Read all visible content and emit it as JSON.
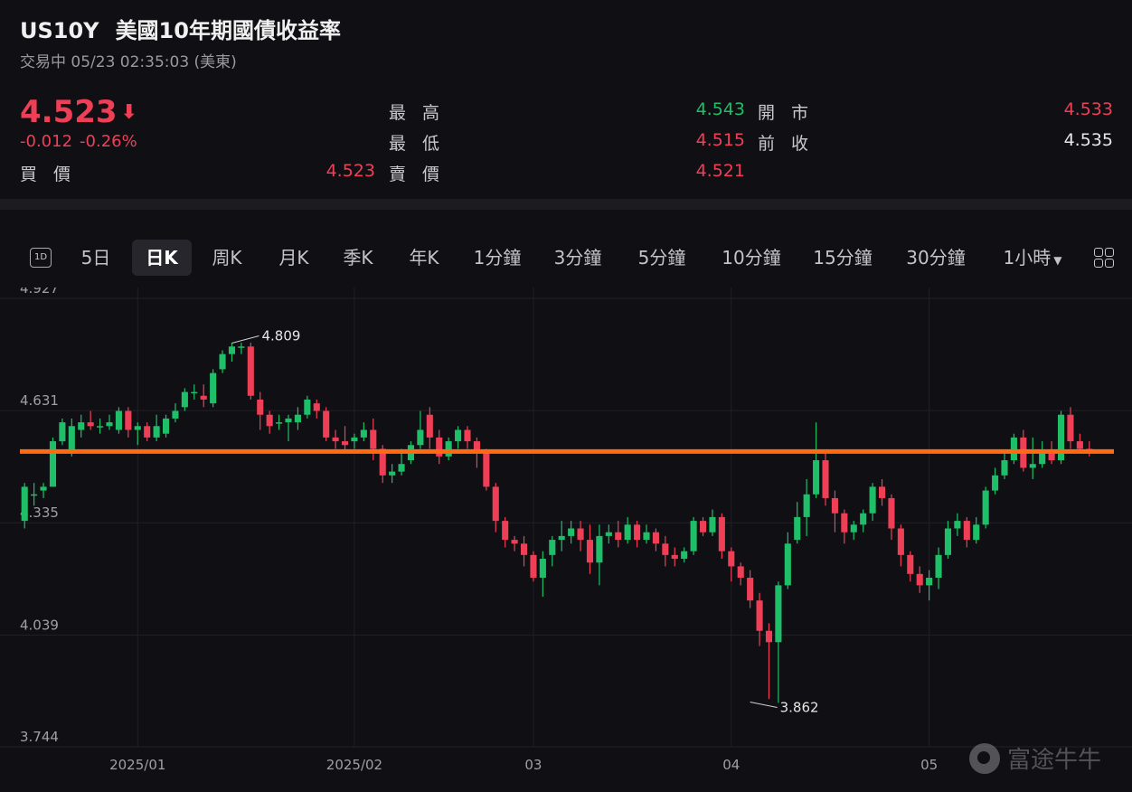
{
  "header": {
    "symbol": "US10Y",
    "name": "美國10年期國債收益率",
    "status": "交易中 05/23 02:35:03 (美東)"
  },
  "quote": {
    "price": "4.523",
    "change": "-0.012",
    "change_pct": "-0.26%",
    "bid_label": "買 價",
    "bid": "4.523",
    "high_label": "最 高",
    "high": "4.543",
    "low_label": "最 低",
    "low": "4.515",
    "ask_label": "賣 價",
    "ask": "4.521",
    "open_label": "開 市",
    "open": "4.533",
    "prev_label": "前 收",
    "prev": "4.535"
  },
  "tabs": [
    "5日",
    "日K",
    "周K",
    "月K",
    "季K",
    "年K",
    "1分鐘",
    "3分鐘",
    "5分鐘",
    "10分鐘",
    "15分鐘",
    "30分鐘",
    "1小時"
  ],
  "tab_oned": "1D",
  "active_tab": "日K",
  "colors": {
    "up": "#1fbf6a",
    "down": "#ee3f57",
    "level_line": "#ff6a13",
    "background": "#101014"
  },
  "watermark": "富途牛牛",
  "chart_data": {
    "type": "candlestick",
    "ylim": [
      3.744,
      4.927
    ],
    "y_ticks": [
      "4.927",
      "4.631",
      "4.335",
      "4.039",
      "3.744"
    ],
    "x_ticks": [
      {
        "label": "2025/01",
        "index": 12
      },
      {
        "label": "2025/02",
        "index": 35
      },
      {
        "label": "03",
        "index": 54
      },
      {
        "label": "04",
        "index": 75
      },
      {
        "label": "05",
        "index": 96
      }
    ],
    "level_line": 4.523,
    "annotations": [
      {
        "label": "4.809",
        "index": 22,
        "value": 4.809
      },
      {
        "label": "3.862",
        "index": 77,
        "value": 3.862
      }
    ],
    "candles": [
      [
        4.34,
        4.43,
        4.44,
        4.32
      ],
      [
        4.41,
        4.41,
        4.44,
        4.38
      ],
      [
        4.42,
        4.43,
        4.44,
        4.4
      ],
      [
        4.43,
        4.55,
        4.56,
        4.43
      ],
      [
        4.55,
        4.6,
        4.61,
        4.54
      ],
      [
        4.52,
        4.59,
        4.61,
        4.51
      ],
      [
        4.58,
        4.6,
        4.62,
        4.56
      ],
      [
        4.6,
        4.59,
        4.63,
        4.58
      ],
      [
        4.59,
        4.59,
        4.61,
        4.57
      ],
      [
        4.59,
        4.6,
        4.62,
        4.58
      ],
      [
        4.58,
        4.63,
        4.64,
        4.57
      ],
      [
        4.63,
        4.58,
        4.64,
        4.56
      ],
      [
        4.58,
        4.59,
        4.6,
        4.54
      ],
      [
        4.59,
        4.56,
        4.6,
        4.55
      ],
      [
        4.56,
        4.59,
        4.62,
        4.55
      ],
      [
        4.57,
        4.61,
        4.62,
        4.56
      ],
      [
        4.61,
        4.63,
        4.65,
        4.6
      ],
      [
        4.64,
        4.68,
        4.69,
        4.63
      ],
      [
        4.68,
        4.68,
        4.7,
        4.66
      ],
      [
        4.67,
        4.66,
        4.7,
        4.64
      ],
      [
        4.65,
        4.73,
        4.74,
        4.64
      ],
      [
        4.74,
        4.78,
        4.79,
        4.73
      ],
      [
        4.78,
        4.8,
        4.81,
        4.76
      ],
      [
        4.8,
        4.8,
        4.81,
        4.78
      ],
      [
        4.8,
        4.67,
        4.81,
        4.66
      ],
      [
        4.66,
        4.62,
        4.68,
        4.58
      ],
      [
        4.62,
        4.59,
        4.63,
        4.57
      ],
      [
        4.6,
        4.6,
        4.62,
        4.58
      ],
      [
        4.6,
        4.61,
        4.62,
        4.55
      ],
      [
        4.6,
        4.62,
        4.64,
        4.58
      ],
      [
        4.62,
        4.66,
        4.67,
        4.61
      ],
      [
        4.65,
        4.63,
        4.66,
        4.61
      ],
      [
        4.63,
        4.56,
        4.64,
        4.55
      ],
      [
        4.56,
        4.55,
        4.58,
        4.53
      ],
      [
        4.55,
        4.54,
        4.59,
        4.52
      ],
      [
        4.55,
        4.56,
        4.57,
        4.53
      ],
      [
        4.56,
        4.58,
        4.6,
        4.55
      ],
      [
        4.58,
        4.53,
        4.61,
        4.5
      ],
      [
        4.53,
        4.46,
        4.54,
        4.44
      ],
      [
        4.46,
        4.47,
        4.49,
        4.44
      ],
      [
        4.47,
        4.49,
        4.53,
        4.46
      ],
      [
        4.5,
        4.54,
        4.55,
        4.49
      ],
      [
        4.54,
        4.58,
        4.63,
        4.53
      ],
      [
        4.62,
        4.56,
        4.64,
        4.53
      ],
      [
        4.56,
        4.51,
        4.58,
        4.49
      ],
      [
        4.51,
        4.55,
        4.56,
        4.5
      ],
      [
        4.55,
        4.58,
        4.59,
        4.53
      ],
      [
        4.58,
        4.55,
        4.59,
        4.53
      ],
      [
        4.55,
        4.52,
        4.56,
        4.48
      ],
      [
        4.52,
        4.43,
        4.53,
        4.42
      ],
      [
        4.43,
        4.34,
        4.44,
        4.31
      ],
      [
        4.34,
        4.29,
        4.35,
        4.27
      ],
      [
        4.29,
        4.28,
        4.3,
        4.26
      ],
      [
        4.28,
        4.25,
        4.3,
        4.22
      ],
      [
        4.25,
        4.19,
        4.26,
        4.18
      ],
      [
        4.19,
        4.24,
        4.26,
        4.14
      ],
      [
        4.25,
        4.29,
        4.3,
        4.22
      ],
      [
        4.29,
        4.3,
        4.34,
        4.26
      ],
      [
        4.3,
        4.32,
        4.34,
        4.28
      ],
      [
        4.32,
        4.29,
        4.34,
        4.26
      ],
      [
        4.29,
        4.23,
        4.33,
        4.2
      ],
      [
        4.23,
        4.3,
        4.33,
        4.17
      ],
      [
        4.3,
        4.31,
        4.33,
        4.28
      ],
      [
        4.31,
        4.29,
        4.34,
        4.27
      ],
      [
        4.29,
        4.33,
        4.35,
        4.28
      ],
      [
        4.33,
        4.29,
        4.34,
        4.27
      ],
      [
        4.29,
        4.31,
        4.33,
        4.28
      ],
      [
        4.31,
        4.28,
        4.32,
        4.26
      ],
      [
        4.28,
        4.25,
        4.3,
        4.22
      ],
      [
        4.25,
        4.24,
        4.27,
        4.22
      ],
      [
        4.24,
        4.26,
        4.27,
        4.23
      ],
      [
        4.26,
        4.34,
        4.35,
        4.25
      ],
      [
        4.34,
        4.31,
        4.35,
        4.3
      ],
      [
        4.31,
        4.35,
        4.37,
        4.3
      ],
      [
        4.35,
        4.26,
        4.36,
        4.24
      ],
      [
        4.26,
        4.22,
        4.27,
        4.18
      ],
      [
        4.22,
        4.19,
        4.23,
        4.17
      ],
      [
        4.19,
        4.13,
        4.21,
        4.11
      ],
      [
        4.13,
        4.05,
        4.15,
        4.01
      ],
      [
        4.05,
        4.02,
        4.07,
        3.87
      ],
      [
        4.02,
        4.17,
        4.18,
        3.86
      ],
      [
        4.17,
        4.28,
        4.31,
        4.16
      ],
      [
        4.29,
        4.35,
        4.39,
        4.28
      ],
      [
        4.35,
        4.41,
        4.45,
        4.3
      ],
      [
        4.41,
        4.5,
        4.6,
        4.4
      ],
      [
        4.5,
        4.4,
        4.52,
        4.38
      ],
      [
        4.4,
        4.36,
        4.42,
        4.31
      ],
      [
        4.36,
        4.31,
        4.37,
        4.28
      ],
      [
        4.31,
        4.33,
        4.34,
        4.29
      ],
      [
        4.33,
        4.36,
        4.37,
        4.31
      ],
      [
        4.36,
        4.43,
        4.44,
        4.34
      ],
      [
        4.43,
        4.4,
        4.45,
        4.38
      ],
      [
        4.4,
        4.32,
        4.41,
        4.29
      ],
      [
        4.32,
        4.25,
        4.33,
        4.22
      ],
      [
        4.25,
        4.2,
        4.26,
        4.18
      ],
      [
        4.2,
        4.17,
        4.22,
        4.15
      ],
      [
        4.17,
        4.19,
        4.21,
        4.13
      ],
      [
        4.19,
        4.25,
        4.27,
        4.16
      ],
      [
        4.25,
        4.32,
        4.34,
        4.24
      ],
      [
        4.32,
        4.34,
        4.36,
        4.3
      ],
      [
        4.34,
        4.29,
        4.35,
        4.27
      ],
      [
        4.29,
        4.33,
        4.35,
        4.28
      ],
      [
        4.33,
        4.42,
        4.43,
        4.32
      ],
      [
        4.42,
        4.46,
        4.48,
        4.41
      ],
      [
        4.46,
        4.5,
        4.52,
        4.45
      ],
      [
        4.5,
        4.56,
        4.57,
        4.49
      ],
      [
        4.56,
        4.48,
        4.58,
        4.47
      ],
      [
        4.48,
        4.49,
        4.56,
        4.45
      ],
      [
        4.49,
        4.52,
        4.55,
        4.48
      ],
      [
        4.52,
        4.5,
        4.55,
        4.49
      ],
      [
        4.5,
        4.62,
        4.63,
        4.49
      ],
      [
        4.62,
        4.55,
        4.64,
        4.53
      ],
      [
        4.55,
        4.53,
        4.57,
        4.52
      ],
      [
        4.53,
        4.52,
        4.55,
        4.51
      ]
    ]
  }
}
